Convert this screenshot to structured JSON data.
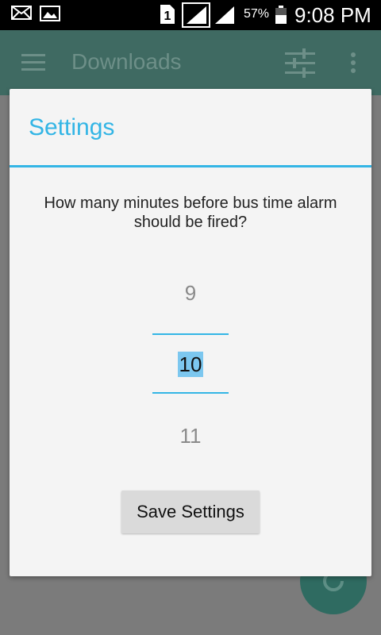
{
  "status_bar": {
    "battery_percent": "57%",
    "time": "9:08 PM",
    "sim_slot": "1",
    "icons": [
      "mail-icon",
      "image-icon",
      "sim-icon",
      "signal-icon",
      "signal-icon",
      "battery-icon"
    ]
  },
  "app_bar": {
    "title": "Downloads",
    "icons": [
      "menu-icon",
      "tune-icon",
      "more-vert-icon"
    ]
  },
  "dialog": {
    "title": "Settings",
    "message": "How many minutes before bus time alarm should be fired?",
    "picker": {
      "previous": "9",
      "current": "10",
      "next": "11"
    },
    "save_button": "Save Settings"
  },
  "fab": {
    "icon": "refresh-icon"
  },
  "colors": {
    "accent": "#33b5e5",
    "app_bar": "#3f6a62",
    "scrim": "#7b7b7b",
    "dialog_bg": "#f4f4f4",
    "selection": "#7cc7ef"
  }
}
